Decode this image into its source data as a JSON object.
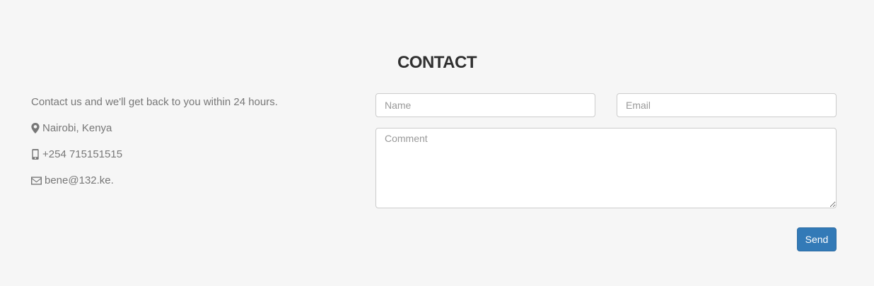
{
  "title": "CONTACT",
  "intro": "Contact us and we'll get back to you within 24 hours.",
  "location": "Nairobi, Kenya",
  "phone": "+254 715151515",
  "email": "bene@132.ke.",
  "icons": {
    "location": "map-marker-icon",
    "phone": "phone-icon",
    "email": "envelope-icon"
  },
  "form": {
    "name_placeholder": "Name",
    "email_placeholder": "Email",
    "comment_placeholder": "Comment",
    "send_label": "Send"
  },
  "colors": {
    "accent": "#337ab7",
    "background": "#f6f6f6"
  }
}
